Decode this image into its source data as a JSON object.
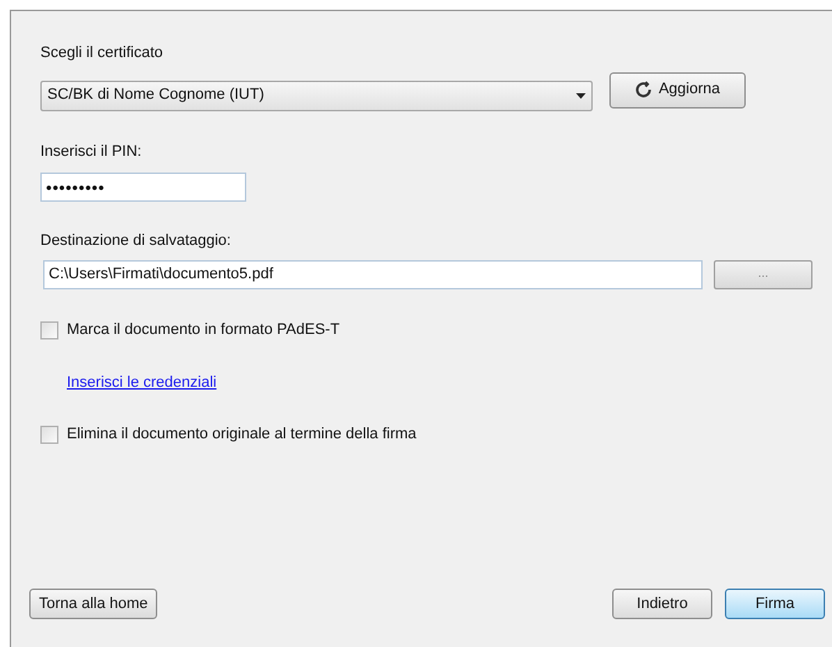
{
  "certificate": {
    "label": "Scegli il certificato",
    "value": "SC/BK di Nome Cognome  (IUT)",
    "refresh_button": "Aggiorna"
  },
  "pin": {
    "label": "Inserisci il PIN:",
    "value": "•••••••••"
  },
  "destination": {
    "label": "Destinazione di salvataggio:",
    "value": "C:\\Users\\Firmati\\documento5.pdf",
    "browse_button": "..."
  },
  "options": [
    {
      "kind": "checkbox",
      "label": "Marca il documento in formato PAdES-T",
      "checked": false
    },
    {
      "kind": "link",
      "label": "Inserisci le credenziali"
    },
    {
      "kind": "checkbox",
      "label": "Elimina il documento originale al termine della firma",
      "checked": false
    }
  ],
  "buttons": [
    {
      "label": "Torna alla home",
      "default": false
    },
    {
      "label": "Indietro",
      "default": false
    },
    {
      "label": "Firma",
      "default": true
    }
  ]
}
